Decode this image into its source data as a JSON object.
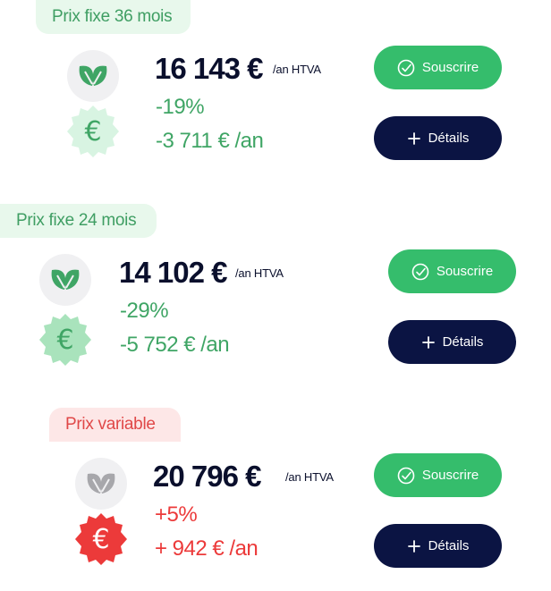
{
  "offers": [
    {
      "tag": "Prix fixe 36 mois",
      "price": "16 143 €",
      "unit": "/an HTVA",
      "percent": "-19%",
      "savings": "-3 711 € /an",
      "euro_symbol": "€"
    },
    {
      "tag": "Prix fixe 24 mois",
      "price": "14 102 €",
      "unit": "/an HTVA",
      "percent": "-29%",
      "savings": "-5 752 € /an",
      "euro_symbol": "€"
    },
    {
      "tag": "Prix variable",
      "price": "20 796 €",
      "unit": "/an HTVA",
      "percent": "+5%",
      "savings": "+ 942 € /an",
      "euro_symbol": "€"
    }
  ],
  "buttons": {
    "subscribe_label": "Souscrire",
    "details_label": "Détails"
  },
  "colors": {
    "green": "#35bd6c",
    "navy": "#0b1443",
    "red": "#ec3a3a",
    "light_green": "#e8f8ec",
    "light_red": "#fde7e7"
  },
  "icons": {
    "leaf": "leaf-icon",
    "euro_badge": "euro-badge-icon",
    "check": "check-circle-icon",
    "plus": "plus-icon"
  }
}
